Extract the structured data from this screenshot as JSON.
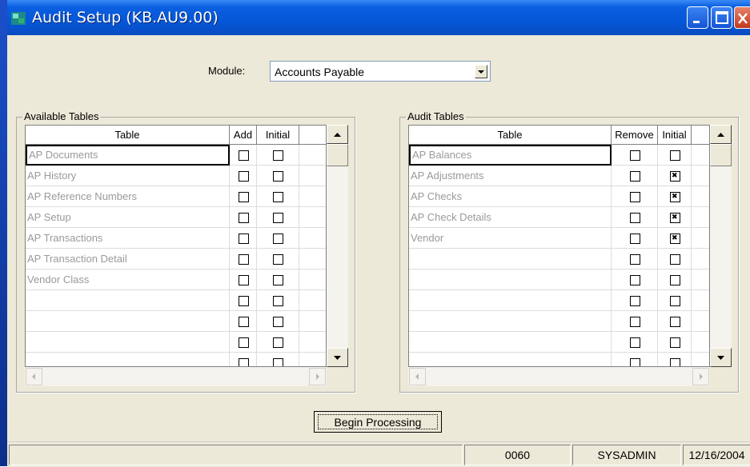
{
  "window": {
    "title": "Audit Setup (KB.AU9.00)"
  },
  "module": {
    "label": "Module:",
    "selected": "Accounts Payable"
  },
  "available": {
    "group_label": "Available Tables",
    "columns": [
      "Table",
      "Add",
      "Initial"
    ],
    "rows": [
      {
        "name": "AP Documents",
        "add": false,
        "initial": false
      },
      {
        "name": "AP History",
        "add": false,
        "initial": false
      },
      {
        "name": "AP Reference Numbers",
        "add": false,
        "initial": false
      },
      {
        "name": "AP Setup",
        "add": false,
        "initial": false
      },
      {
        "name": "AP Transactions",
        "add": false,
        "initial": false
      },
      {
        "name": "AP Transaction Detail",
        "add": false,
        "initial": false
      },
      {
        "name": "Vendor Class",
        "add": false,
        "initial": false
      },
      {
        "name": "",
        "add": false,
        "initial": false
      },
      {
        "name": "",
        "add": false,
        "initial": false
      },
      {
        "name": "",
        "add": false,
        "initial": false
      },
      {
        "name": "",
        "add": false,
        "initial": false
      }
    ]
  },
  "audit": {
    "group_label": "Audit Tables",
    "columns": [
      "Table",
      "Remove",
      "Initial"
    ],
    "rows": [
      {
        "name": "AP Balances",
        "remove": false,
        "initial": false
      },
      {
        "name": "AP Adjustments",
        "remove": false,
        "initial": true
      },
      {
        "name": "AP Checks",
        "remove": false,
        "initial": true
      },
      {
        "name": "AP Check Details",
        "remove": false,
        "initial": true
      },
      {
        "name": "Vendor",
        "remove": false,
        "initial": true
      },
      {
        "name": "",
        "remove": false,
        "initial": false
      },
      {
        "name": "",
        "remove": false,
        "initial": false
      },
      {
        "name": "",
        "remove": false,
        "initial": false
      },
      {
        "name": "",
        "remove": false,
        "initial": false
      },
      {
        "name": "",
        "remove": false,
        "initial": false
      },
      {
        "name": "",
        "remove": false,
        "initial": false
      }
    ]
  },
  "actions": {
    "begin_label": "Begin Processing"
  },
  "status": {
    "code": "0060",
    "user": "SYSADMIN",
    "date": "12/16/2004"
  }
}
